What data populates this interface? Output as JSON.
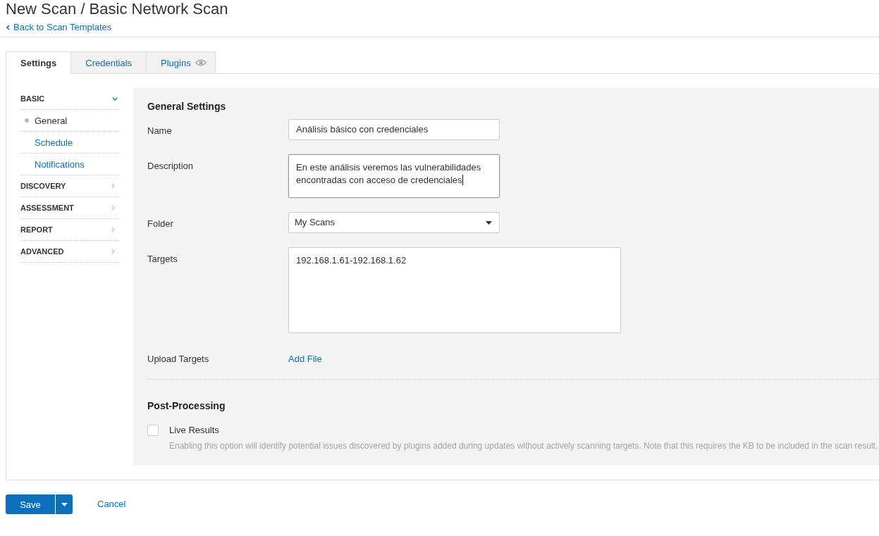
{
  "page": {
    "title": "New Scan / Basic Network Scan",
    "back_link": "Back to Scan Templates"
  },
  "tabs": [
    {
      "label": "Settings",
      "selected": true,
      "kind": "plain"
    },
    {
      "label": "Credentials",
      "selected": false,
      "kind": "plain"
    },
    {
      "label": "Plugins",
      "selected": false,
      "kind": "badged"
    }
  ],
  "sidebar": {
    "sections": [
      {
        "label": "BASIC",
        "expanded": true,
        "items": [
          {
            "label": "General",
            "selected": true
          },
          {
            "label": "Schedule",
            "selected": false
          },
          {
            "label": "Notifications",
            "selected": false
          }
        ]
      },
      {
        "label": "DISCOVERY",
        "expanded": false
      },
      {
        "label": "ASSESSMENT",
        "expanded": false
      },
      {
        "label": "REPORT",
        "expanded": false
      },
      {
        "label": "ADVANCED",
        "expanded": false
      }
    ]
  },
  "general_settings": {
    "title": "General Settings",
    "fields": [
      {
        "kind": "text",
        "label": "Name",
        "value": "Análisis básico con credenciales",
        "focused": false
      },
      {
        "kind": "textarea",
        "label": "Description",
        "value": "En este análisis veremos las vulnerabilidades encontradas con acceso de credenciales",
        "focused": true
      },
      {
        "kind": "select",
        "label": "Folder",
        "value": "My Scans",
        "focused": false
      },
      {
        "kind": "textblock",
        "label": "Targets",
        "value": "192.168.1.61-192.168.1.62",
        "focused": false
      },
      {
        "kind": "link",
        "label": "Upload Targets",
        "value": "Add File",
        "focused": false
      }
    ]
  },
  "post_processing": {
    "title": "Post-Processing",
    "options": [
      {
        "label": "Live Results",
        "checked": false,
        "description": "Enabling this option will identify potential issues discovered by plugins added during updates without actively scanning targets. Note that this requires the KB to be included in the scan result."
      }
    ]
  },
  "footer": {
    "save": "Save",
    "cancel": "Cancel"
  }
}
